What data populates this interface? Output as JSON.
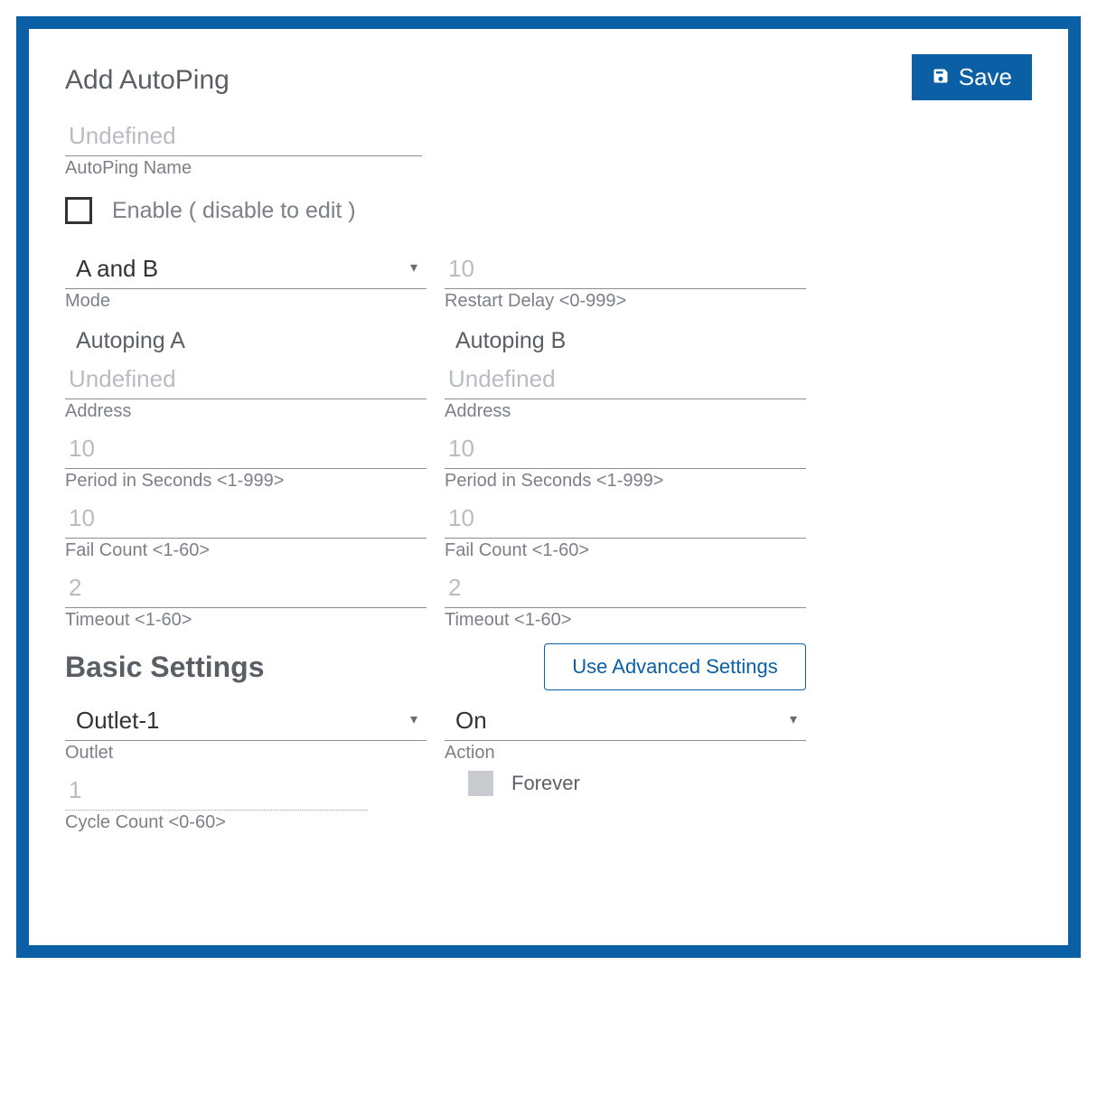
{
  "header": {
    "title": "Add AutoPing",
    "save_label": "Save"
  },
  "name_field": {
    "placeholder": "Undefined",
    "label": "AutoPing Name"
  },
  "enable": {
    "label": "Enable ( disable to edit )",
    "checked": false
  },
  "mode": {
    "value": "A and B",
    "label": "Mode"
  },
  "restart_delay": {
    "placeholder": "10",
    "label": "Restart Delay <0-999>"
  },
  "autoping_a": {
    "heading": "Autoping A",
    "address_placeholder": "Undefined",
    "address_label": "Address",
    "period_placeholder": "10",
    "period_label": "Period in Seconds <1-999>",
    "failcount_placeholder": "10",
    "failcount_label": "Fail Count <1-60>",
    "timeout_placeholder": "2",
    "timeout_label": "Timeout <1-60>"
  },
  "autoping_b": {
    "heading": "Autoping B",
    "address_placeholder": "Undefined",
    "address_label": "Address",
    "period_placeholder": "10",
    "period_label": "Period in Seconds <1-999>",
    "failcount_placeholder": "10",
    "failcount_label": "Fail Count <1-60>",
    "timeout_placeholder": "2",
    "timeout_label": "Timeout <1-60>"
  },
  "basic": {
    "title": "Basic Settings",
    "advanced_button": "Use Advanced Settings",
    "outlet_value": "Outlet-1",
    "outlet_label": "Outlet",
    "action_value": "On",
    "action_label": "Action",
    "cycle_placeholder": "1",
    "cycle_label": "Cycle Count <0-60>",
    "forever_label": "Forever"
  }
}
